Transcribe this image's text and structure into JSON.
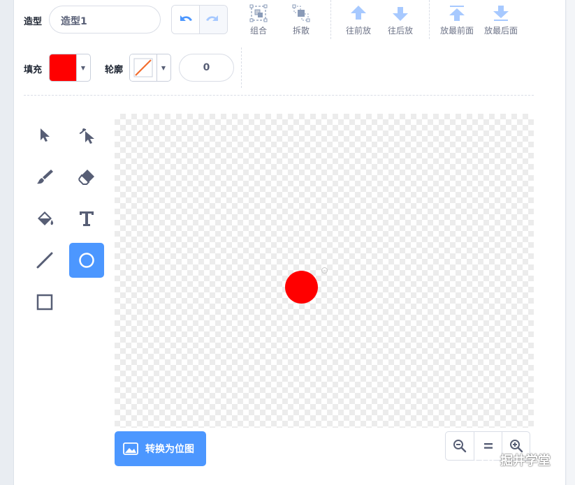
{
  "costume": {
    "label": "造型",
    "name_value": "造型1"
  },
  "arrange": {
    "group_label": "组合",
    "ungroup_label": "拆散",
    "forward_label": "往前放",
    "backward_label": "往后放",
    "front_label": "放最前面",
    "back_label": "放最后面"
  },
  "fill": {
    "label": "填充",
    "color": "#ff0000"
  },
  "outline": {
    "label": "轮廓",
    "color": "none",
    "width_value": "0"
  },
  "tools": [
    "select",
    "reshape",
    "brush",
    "eraser",
    "fill",
    "text",
    "line",
    "circle",
    "rectangle"
  ],
  "active_tool": "circle",
  "canvas": {
    "shape": "circle",
    "shape_color": "#ff0000"
  },
  "convert_button_label": "转换为位图",
  "zoom": {
    "zoom_out": "-",
    "reset": "=",
    "zoom_in": "+"
  },
  "watermark_text": "掘井学堂",
  "accent_color": "#4c97ff"
}
